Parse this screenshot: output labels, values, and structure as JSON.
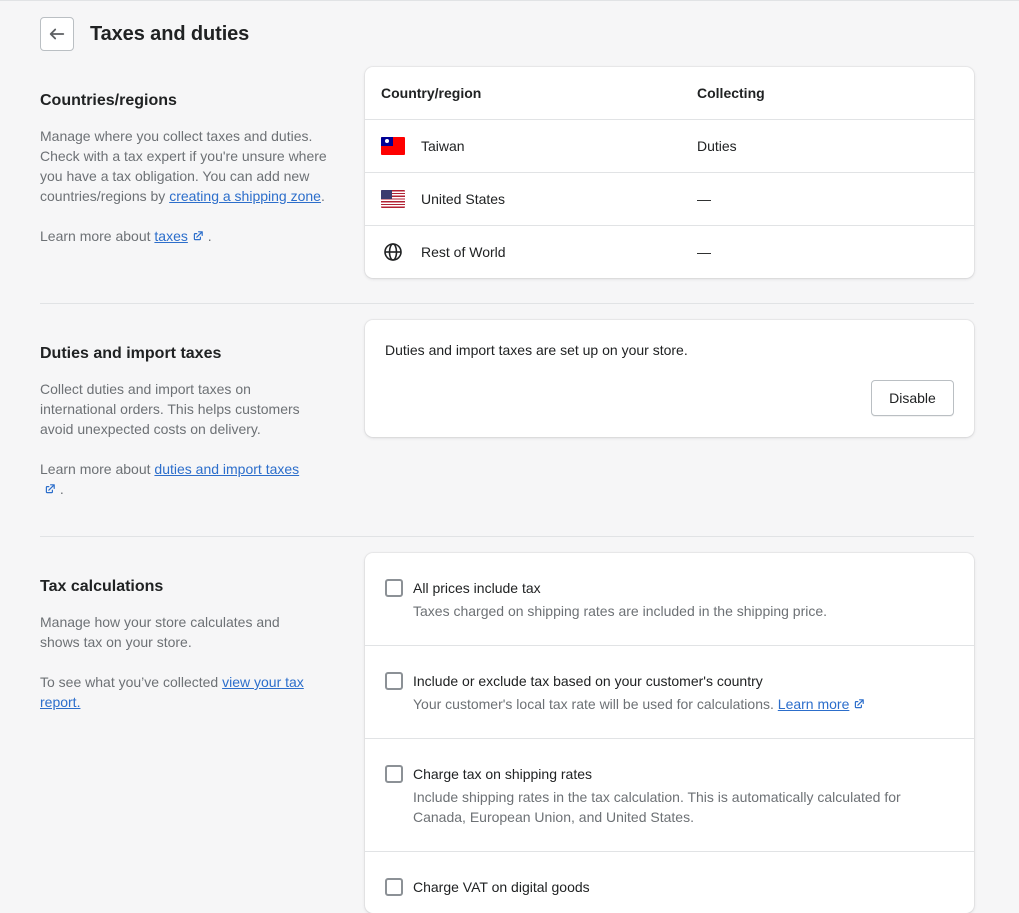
{
  "header": {
    "title": "Taxes and duties"
  },
  "countries": {
    "heading": "Countries/regions",
    "desc_text": "Manage where you collect taxes and duties. Check with a tax expert if you're unsure where you have a tax obligation. You can add new countries/regions by ",
    "desc_link": "creating a shipping zone",
    "desc_end": ".",
    "learn_prefix": "Learn more about ",
    "learn_link": "taxes",
    "learn_end": ".",
    "table": {
      "col_country": "Country/region",
      "col_collecting": "Collecting",
      "rows": [
        {
          "name": "Taiwan",
          "collecting": "Duties",
          "icon": "taiwan-flag-icon"
        },
        {
          "name": "United States",
          "collecting": "—",
          "icon": "us-flag-icon"
        },
        {
          "name": "Rest of World",
          "collecting": "—",
          "icon": "globe-icon"
        }
      ]
    }
  },
  "duties": {
    "heading": "Duties and import taxes",
    "desc_text": "Collect duties and import taxes on international orders. This helps customers avoid unexpected costs on delivery.",
    "learn_prefix": "Learn more about ",
    "learn_link": "duties and import taxes",
    "learn_end": ".",
    "status_text": "Duties and import taxes are set up on your store.",
    "disable_label": "Disable"
  },
  "tax_calc": {
    "heading": "Tax calculations",
    "desc_text": "Manage how your store calculates and shows tax on your store.",
    "report_prefix": "To see what you’ve collected ",
    "report_link": "view your tax report.",
    "options": [
      {
        "label": "All prices include tax",
        "help": "Taxes charged on shipping rates are included in the shipping price.",
        "checked": false
      },
      {
        "label": "Include or exclude tax based on your customer's country",
        "help": "Your customer's local tax rate will be used for calculations.",
        "help_link": "Learn more",
        "checked": false
      },
      {
        "label": "Charge tax on shipping rates",
        "help": "Include shipping rates in the tax calculation. This is automatically calculated for Canada, European Union, and United States.",
        "checked": false
      },
      {
        "label": "Charge VAT on digital goods",
        "help": "",
        "checked": false
      }
    ]
  },
  "colors": {
    "link": "#2c6ecb",
    "border": "#e1e3e5",
    "subdued": "#6d7175",
    "background": "#f6f6f7"
  }
}
